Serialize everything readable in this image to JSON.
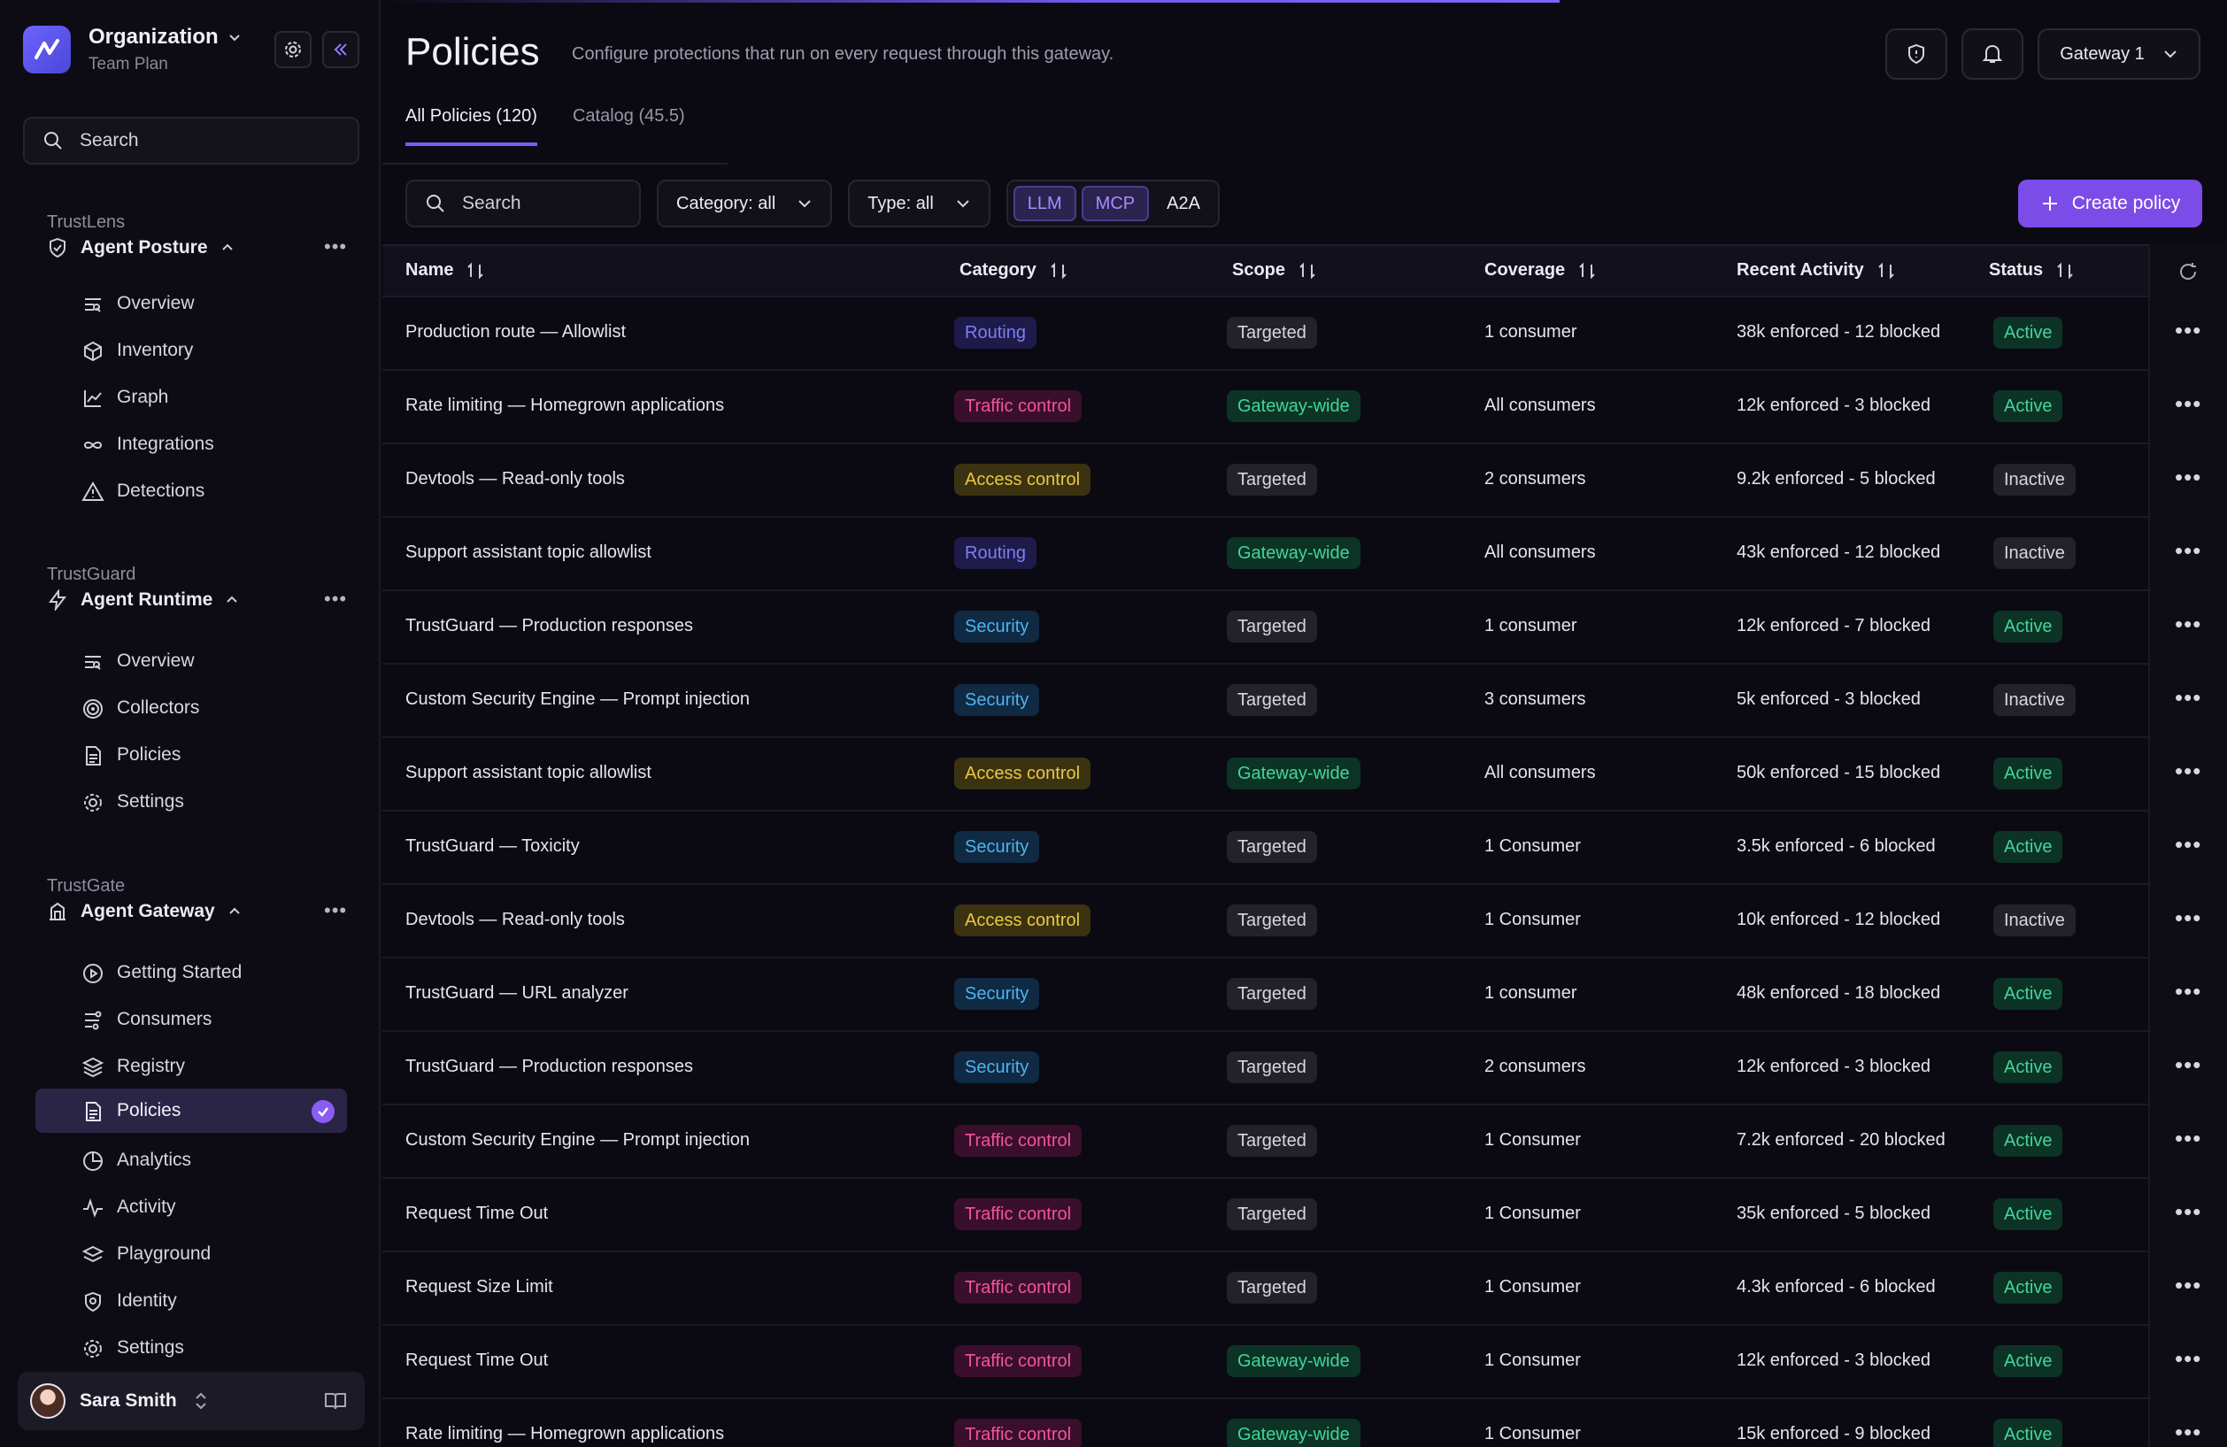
{
  "sidebar": {
    "org_name": "Organization",
    "org_plan": "Team Plan",
    "search_placeholder": "Search",
    "sections": [
      {
        "label": "TrustLens",
        "title": "Agent Posture",
        "items": [
          {
            "label": "Overview",
            "icon": "overview-icon"
          },
          {
            "label": "Inventory",
            "icon": "cube-icon"
          },
          {
            "label": "Graph",
            "icon": "chart-line-icon"
          },
          {
            "label": "Integrations",
            "icon": "infinity-icon"
          },
          {
            "label": "Detections",
            "icon": "warning-triangle-icon"
          }
        ]
      },
      {
        "label": "TrustGuard",
        "title": "Agent Runtime",
        "items": [
          {
            "label": "Overview",
            "icon": "overview-icon"
          },
          {
            "label": "Collectors",
            "icon": "radar-icon"
          },
          {
            "label": "Policies",
            "icon": "document-icon"
          },
          {
            "label": "Settings",
            "icon": "gear-icon"
          }
        ]
      },
      {
        "label": "TrustGate",
        "title": "Agent Gateway",
        "items": [
          {
            "label": "Getting Started",
            "icon": "play-circle-icon"
          },
          {
            "label": "Consumers",
            "icon": "consumers-icon"
          },
          {
            "label": "Registry",
            "icon": "layers-icon"
          },
          {
            "label": "Policies",
            "icon": "document-icon",
            "active": true
          },
          {
            "label": "Analytics",
            "icon": "pie-chart-icon"
          },
          {
            "label": "Activity",
            "icon": "activity-icon"
          },
          {
            "label": "Playground",
            "icon": "stack-icon"
          },
          {
            "label": "Identity",
            "icon": "fingerprint-icon"
          },
          {
            "label": "Settings",
            "icon": "gear-icon"
          }
        ]
      }
    ],
    "user": {
      "name": "Sara Smith"
    }
  },
  "header": {
    "title": "Policies",
    "subtitle": "Configure protections that run on every request through this gateway.",
    "gateway": "Gateway 1"
  },
  "tabs": [
    {
      "label": "All Policies",
      "count": "(120)",
      "active": true
    },
    {
      "label": "Catalog",
      "count": "(45.5)",
      "active": false
    }
  ],
  "toolbar": {
    "search_placeholder": "Search",
    "category": "Category: all",
    "type": "Type: all",
    "segments": [
      {
        "label": "LLM",
        "on": true
      },
      {
        "label": "MCP",
        "on": true
      },
      {
        "label": "A2A",
        "on": false
      }
    ],
    "create_label": "Create policy"
  },
  "table": {
    "columns": [
      "Name",
      "Category",
      "Scope",
      "Coverage",
      "Recent Activity",
      "Status"
    ],
    "rows": [
      {
        "name": "Production route — Allowlist",
        "category": "Routing",
        "scope": "Targeted",
        "coverage": "1 consumer",
        "activity": "38k enforced - 12 blocked",
        "status": "Active"
      },
      {
        "name": "Rate limiting — Homegrown applications",
        "category": "Traffic control",
        "scope": "Gateway-wide",
        "coverage": "All consumers",
        "activity": "12k enforced - 3 blocked",
        "status": "Active"
      },
      {
        "name": "Devtools — Read-only tools",
        "category": "Access control",
        "scope": "Targeted",
        "coverage": "2 consumers",
        "activity": "9.2k enforced - 5 blocked",
        "status": "Inactive"
      },
      {
        "name": "Support assistant topic allowlist",
        "category": "Routing",
        "scope": "Gateway-wide",
        "coverage": "All consumers",
        "activity": "43k enforced - 12 blocked",
        "status": "Inactive"
      },
      {
        "name": "TrustGuard — Production responses",
        "category": "Security",
        "scope": "Targeted",
        "coverage": "1 consumer",
        "activity": "12k enforced - 7 blocked",
        "status": "Active"
      },
      {
        "name": "Custom Security Engine — Prompt injection",
        "category": "Security",
        "scope": "Targeted",
        "coverage": "3 consumers",
        "activity": "5k enforced - 3 blocked",
        "status": "Inactive"
      },
      {
        "name": "Support assistant topic allowlist",
        "category": "Access control",
        "scope": "Gateway-wide",
        "coverage": "All consumers",
        "activity": "50k enforced - 15 blocked",
        "status": "Active"
      },
      {
        "name": "TrustGuard — Toxicity",
        "category": "Security",
        "scope": "Targeted",
        "coverage": "1 Consumer",
        "activity": "3.5k enforced - 6 blocked",
        "status": "Active"
      },
      {
        "name": "Devtools — Read-only tools",
        "category": "Access control",
        "scope": "Targeted",
        "coverage": "1 Consumer",
        "activity": "10k enforced - 12 blocked",
        "status": "Inactive"
      },
      {
        "name": "TrustGuard — URL analyzer",
        "category": "Security",
        "scope": "Targeted",
        "coverage": "1 consumer",
        "activity": "48k enforced - 18 blocked",
        "status": "Active"
      },
      {
        "name": "TrustGuard — Production responses",
        "category": "Security",
        "scope": "Targeted",
        "coverage": "2 consumers",
        "activity": "12k enforced - 3 blocked",
        "status": "Active"
      },
      {
        "name": "Custom Security Engine — Prompt injection",
        "category": "Traffic control",
        "scope": "Targeted",
        "coverage": "1 Consumer",
        "activity": "7.2k enforced - 20 blocked",
        "status": "Active"
      },
      {
        "name": "Request Time Out",
        "category": "Traffic control",
        "scope": "Targeted",
        "coverage": "1 Consumer",
        "activity": "35k enforced - 5 blocked",
        "status": "Active"
      },
      {
        "name": "Request Size Limit",
        "category": "Traffic control",
        "scope": "Targeted",
        "coverage": "1 Consumer",
        "activity": "4.3k enforced - 6 blocked",
        "status": "Active"
      },
      {
        "name": "Request Time Out",
        "category": "Traffic control",
        "scope": "Gateway-wide",
        "coverage": "1 Consumer",
        "activity": "12k enforced - 3 blocked",
        "status": "Active"
      },
      {
        "name": "Rate limiting — Homegrown applications",
        "category": "Traffic control",
        "scope": "Gateway-wide",
        "coverage": "1 Consumer",
        "activity": "15k enforced - 9 blocked",
        "status": "Active"
      }
    ]
  },
  "colors": {
    "accent": "#7c4ce8",
    "routing": "#7f7ef2",
    "traffic_control": "#f0559b",
    "access_control": "#e9c93f",
    "security": "#4fb3f0",
    "active": "#42d69a"
  }
}
